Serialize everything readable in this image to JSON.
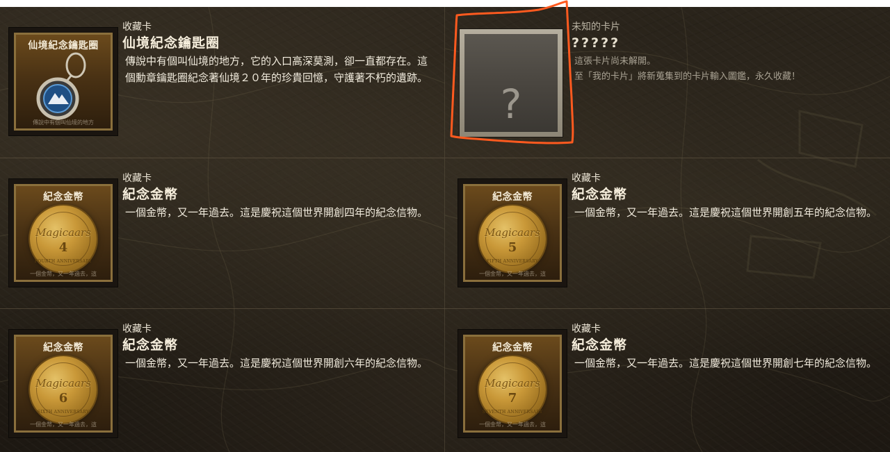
{
  "cards": [
    {
      "category": "收藏卡",
      "name": "仙境紀念鑰匙圈",
      "description": "傳說中有個叫仙境的地方，它的入口高深莫測，卻一直都存在。這個勳章鑰匙圈紀念著仙境２０年的珍貴回憶，守護著不朽的遺跡。",
      "card_title": "仙境紀念鑰匙圈",
      "card_footer": "傳說中有個叫仙境的地方"
    },
    {
      "category": "未知的卡片",
      "name": "?????",
      "description_line1": "這張卡片尚未解開。",
      "description_line2": "至「我的卡片」將新蒐集到的卡片輸入圖鑑，永久收藏！",
      "card_symbol": "?"
    },
    {
      "category": "收藏卡",
      "name": "紀念金幣",
      "description": "一個金幣，又一年過去。這是慶祝這個世界開創四年的紀念信物。",
      "card_title": "紀念金幣",
      "coin_brand": "Magicaars",
      "coin_number": "4",
      "coin_ring": "FOURTH ANNIVERSARY",
      "card_footer": "一個金幣，又一年過去，這"
    },
    {
      "category": "收藏卡",
      "name": "紀念金幣",
      "description": "一個金幣，又一年過去。這是慶祝這個世界開創五年的紀念信物。",
      "card_title": "紀念金幣",
      "coin_brand": "Magicaars",
      "coin_number": "5",
      "coin_ring": "FIFTH ANNIVERSARY",
      "card_footer": "一個金幣，又一年過去，這"
    },
    {
      "category": "收藏卡",
      "name": "紀念金幣",
      "description": "一個金幣，又一年過去。這是慶祝這個世界開創六年的紀念信物。",
      "card_title": "紀念金幣",
      "coin_brand": "Magicaars",
      "coin_number": "6",
      "coin_ring": "SIXTH ANNIVERSARY",
      "card_footer": "一個金幣，又一年過去，這"
    },
    {
      "category": "收藏卡",
      "name": "紀念金幣",
      "description": "一個金幣，又一年過去。這是慶祝這個世界開創七年的紀念信物。",
      "card_title": "紀念金幣",
      "coin_brand": "Magicaars",
      "coin_number": "7",
      "coin_ring": "SEVENTH ANNIVERSARY",
      "card_footer": "一個金幣，又一年過去，這"
    }
  ],
  "colors": {
    "background": "#231e16",
    "card_frame_gold": "#8a6f3c",
    "coin_gold": "#c99838",
    "highlight_outline": "#ff5a1f"
  }
}
